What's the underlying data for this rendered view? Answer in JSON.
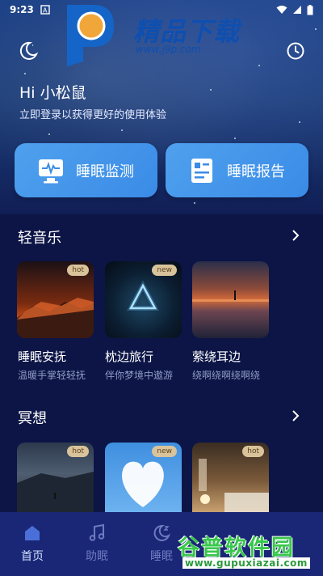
{
  "status_bar": {
    "time": "9:23"
  },
  "watermark_top": {
    "brand": "精品下载",
    "url": "www.j9p.com"
  },
  "header": {
    "greeting": "Hi 小松鼠",
    "login_hint": "立即登录以获得更好的使用体验"
  },
  "features": [
    {
      "label": "睡眠监测",
      "icon": "monitor-wave-icon"
    },
    {
      "label": "睡眠报告",
      "icon": "report-icon"
    }
  ],
  "sections": {
    "music": {
      "title": "轻音乐",
      "items": [
        {
          "title": "睡眠安抚",
          "subtitle": "温暖手掌轻轻抚",
          "badge": "hot"
        },
        {
          "title": "枕边旅行",
          "subtitle": "伴你梦境中遨游",
          "badge": "new"
        },
        {
          "title": "萦绕耳边",
          "subtitle": "绕啊绕啊绕啊绕",
          "badge": ""
        }
      ]
    },
    "meditation": {
      "title": "冥想",
      "items": [
        {
          "badge": "hot"
        },
        {
          "badge": "new"
        },
        {
          "badge": "hot"
        }
      ]
    }
  },
  "bottom_nav": [
    {
      "label": "首页",
      "icon": "home-icon",
      "active": true
    },
    {
      "label": "助眠",
      "icon": "music-note-icon",
      "active": false
    },
    {
      "label": "睡眠",
      "icon": "moon-z-icon",
      "active": false
    }
  ],
  "watermark_bottom": {
    "brand": "谷普软件园",
    "url": "www.gupuxiazai.com"
  },
  "colors": {
    "accent": "#3a8be6",
    "background": "#0c1546",
    "nav_bg": "#1a2676",
    "badge": "#d9c39a"
  }
}
